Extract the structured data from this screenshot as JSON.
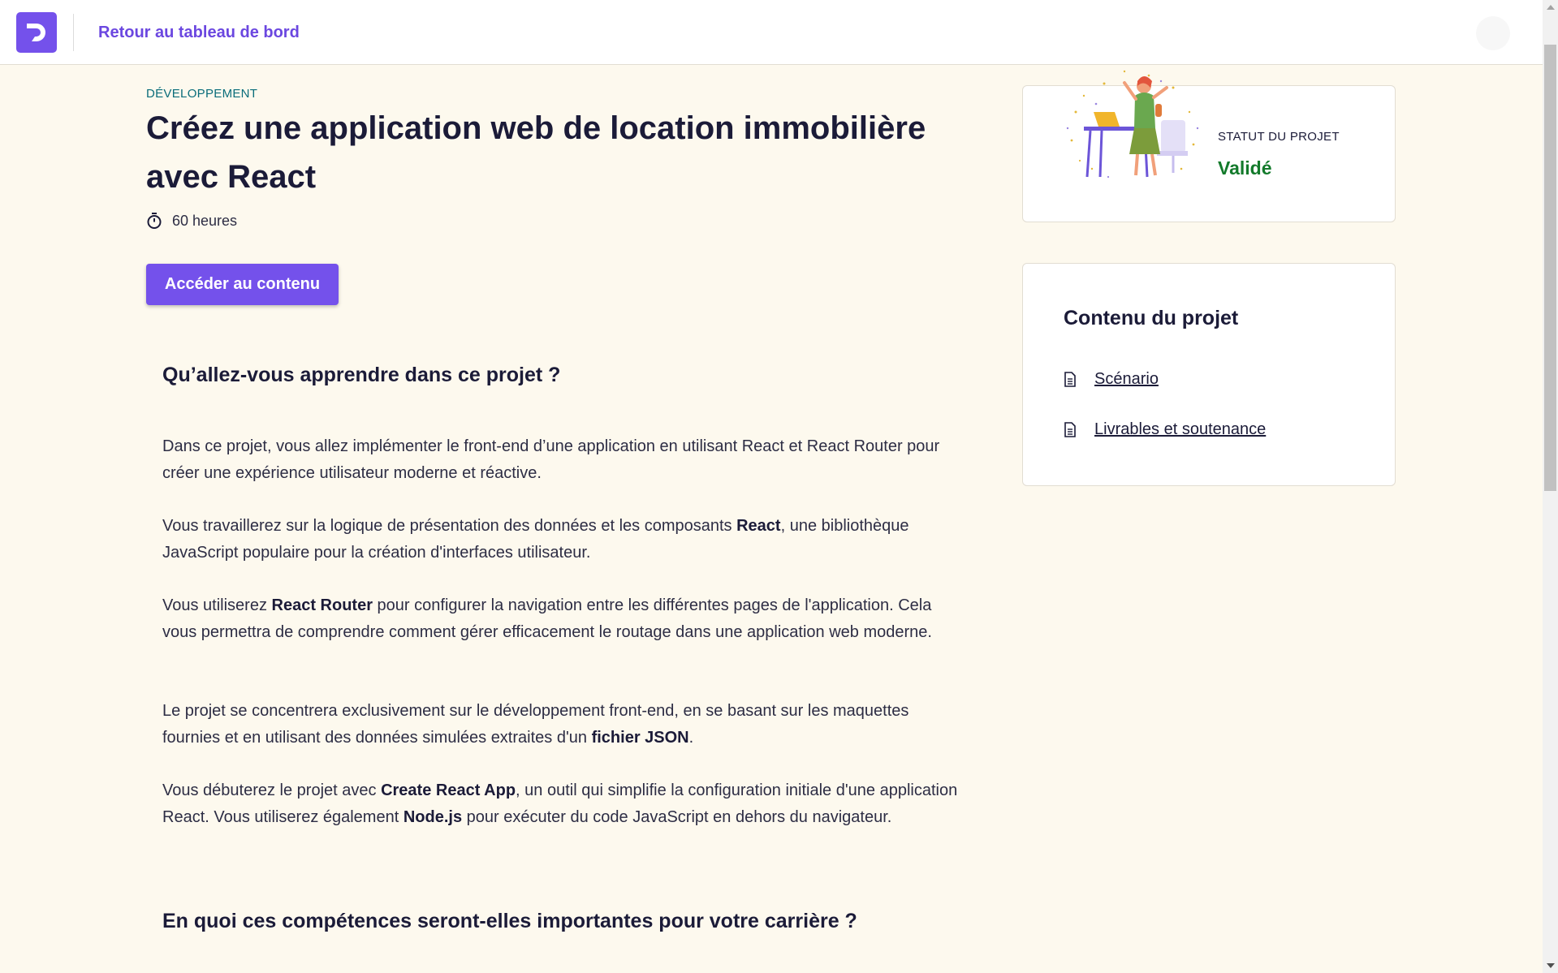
{
  "header": {
    "back_label": "Retour au tableau de bord",
    "logo_icon": "openclassrooms-logo-icon"
  },
  "project": {
    "category": "DÉVELOPPEMENT",
    "title": "Créez une application web de location immobilière avec React",
    "duration": "60 heures",
    "cta_label": "Accéder au contenu"
  },
  "status": {
    "label": "STATUT DU PROJET",
    "value": "Validé",
    "value_color": "#137a2b"
  },
  "contents": {
    "title": "Contenu du projet",
    "items": [
      {
        "label": "Scénario",
        "icon": "document-icon"
      },
      {
        "label": "Livrables et soutenance",
        "icon": "document-icon"
      }
    ]
  },
  "learn": {
    "heading": "Qu’allez-vous apprendre dans ce projet ?",
    "paragraphs": [
      {
        "segments": [
          {
            "text": "Dans ce projet, vous allez implémenter le front-end d’une application en utilisant React et React Router pour créer une expérience utilisateur moderne et réactive.",
            "bold": false
          }
        ]
      },
      {
        "segments": [
          {
            "text": "Vous travaillerez sur la logique de présentation des données et les composants ",
            "bold": false
          },
          {
            "text": "React",
            "bold": true
          },
          {
            "text": ", une bibliothèque JavaScript populaire pour la création d'interfaces utilisateur.",
            "bold": false
          }
        ]
      },
      {
        "segments": [
          {
            "text": "Vous utiliserez ",
            "bold": false
          },
          {
            "text": "React Router",
            "bold": true
          },
          {
            "text": " pour configurer la navigation entre les différentes pages de l'application. Cela vous permettra de comprendre comment gérer efficacement le routage dans une application web moderne.",
            "bold": false
          }
        ]
      },
      {
        "segments": [
          {
            "text": "Le projet se concentrera exclusivement sur le développement front-end, en se basant sur les maquettes fournies et en utilisant des données simulées extraites d'un ",
            "bold": false
          },
          {
            "text": "fichier JSON",
            "bold": true
          },
          {
            "text": ".",
            "bold": false
          }
        ]
      },
      {
        "segments": [
          {
            "text": "Vous débuterez le projet avec ",
            "bold": false
          },
          {
            "text": "Create React App",
            "bold": true
          },
          {
            "text": ", un outil qui simplifie la configuration initiale d'une application React. Vous utiliserez également ",
            "bold": false
          },
          {
            "text": "Node.js",
            "bold": true
          },
          {
            "text": " pour exécuter du code JavaScript en dehors du navigateur.",
            "bold": false
          }
        ]
      }
    ]
  },
  "career": {
    "heading": "En quoi ces compétences seront-elles importantes pour votre carrière ?"
  },
  "colors": {
    "accent": "#7451eb",
    "background": "#fdf9ee",
    "category": "#0a6d7a"
  }
}
